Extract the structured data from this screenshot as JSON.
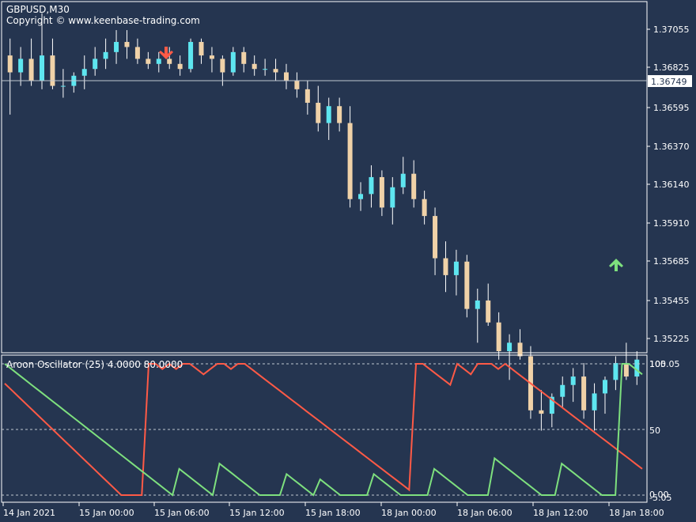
{
  "window": {
    "symbol_timeframe": "GBPUSD,M30",
    "copyright": "Copyright © www.keenbase-trading.com"
  },
  "price_axis": {
    "ticks": [
      "1.37055",
      "1.36825",
      "1.36595",
      "1.36370",
      "1.36140",
      "1.35910",
      "1.35685",
      "1.35455",
      "1.35225"
    ],
    "current_price": "1.36749"
  },
  "indicator": {
    "label": "Aroon Oscillator (25) 4.0000 80.0000",
    "axis_labels": [
      "105.05",
      "100",
      "50",
      "0.00",
      "-5.05"
    ]
  },
  "time_axis": {
    "labels": [
      "14 Jan 2021",
      "15 Jan 00:00",
      "15 Jan 06:00",
      "15 Jan 12:00",
      "15 Jan 18:00",
      "18 Jan 00:00",
      "18 Jan 06:00",
      "18 Jan 12:00",
      "18 Jan 18:00"
    ]
  },
  "signals": [
    {
      "type": "sell",
      "icon": "down-arrow-icon",
      "color": "#ff5a46"
    },
    {
      "type": "buy",
      "icon": "up-arrow-icon",
      "color": "#7ee07e"
    }
  ],
  "colors": {
    "background": "#253550",
    "bull_candle": "#5ee6f0",
    "bear_candle": "#f0d2a8",
    "aroon_up": "#7ee07e",
    "aroon_down": "#ff5a46",
    "grid": "#ffffff"
  },
  "chart_data": {
    "type": "candlestick",
    "price_series": [
      {
        "o": 1.369,
        "h": 1.37,
        "l": 1.3655,
        "c": 1.368
      },
      {
        "o": 1.368,
        "h": 1.3695,
        "l": 1.3672,
        "c": 1.3688
      },
      {
        "o": 1.3688,
        "h": 1.37,
        "l": 1.3672,
        "c": 1.3675
      },
      {
        "o": 1.3675,
        "h": 1.3715,
        "l": 1.367,
        "c": 1.369
      },
      {
        "o": 1.369,
        "h": 1.37,
        "l": 1.367,
        "c": 1.3672
      },
      {
        "o": 1.3672,
        "h": 1.3682,
        "l": 1.3665,
        "c": 1.3672
      },
      {
        "o": 1.3672,
        "h": 1.368,
        "l": 1.3668,
        "c": 1.3678
      },
      {
        "o": 1.3678,
        "h": 1.369,
        "l": 1.367,
        "c": 1.3682
      },
      {
        "o": 1.3682,
        "h": 1.3695,
        "l": 1.3678,
        "c": 1.3688
      },
      {
        "o": 1.3688,
        "h": 1.37,
        "l": 1.3682,
        "c": 1.3692
      },
      {
        "o": 1.3692,
        "h": 1.3705,
        "l": 1.3685,
        "c": 1.3698
      },
      {
        "o": 1.3698,
        "h": 1.3705,
        "l": 1.3688,
        "c": 1.3695
      },
      {
        "o": 1.3695,
        "h": 1.37,
        "l": 1.3685,
        "c": 1.3688
      },
      {
        "o": 1.3688,
        "h": 1.3692,
        "l": 1.3682,
        "c": 1.3685
      },
      {
        "o": 1.3685,
        "h": 1.3692,
        "l": 1.368,
        "c": 1.3688
      },
      {
        "o": 1.3688,
        "h": 1.3695,
        "l": 1.3682,
        "c": 1.3685
      },
      {
        "o": 1.3685,
        "h": 1.369,
        "l": 1.3678,
        "c": 1.3682
      },
      {
        "o": 1.3682,
        "h": 1.37,
        "l": 1.368,
        "c": 1.3698
      },
      {
        "o": 1.3698,
        "h": 1.37,
        "l": 1.3685,
        "c": 1.369
      },
      {
        "o": 1.369,
        "h": 1.3695,
        "l": 1.368,
        "c": 1.3688
      },
      {
        "o": 1.3688,
        "h": 1.369,
        "l": 1.3672,
        "c": 1.368
      },
      {
        "o": 1.368,
        "h": 1.3695,
        "l": 1.3678,
        "c": 1.3692
      },
      {
        "o": 1.3692,
        "h": 1.3695,
        "l": 1.368,
        "c": 1.3685
      },
      {
        "o": 1.3685,
        "h": 1.369,
        "l": 1.3678,
        "c": 1.3682
      },
      {
        "o": 1.3682,
        "h": 1.3688,
        "l": 1.3678,
        "c": 1.3682
      },
      {
        "o": 1.3682,
        "h": 1.3688,
        "l": 1.3675,
        "c": 1.368
      },
      {
        "o": 1.368,
        "h": 1.3685,
        "l": 1.367,
        "c": 1.3675
      },
      {
        "o": 1.3675,
        "h": 1.368,
        "l": 1.3665,
        "c": 1.367
      },
      {
        "o": 1.367,
        "h": 1.3675,
        "l": 1.3655,
        "c": 1.3662
      },
      {
        "o": 1.3662,
        "h": 1.3672,
        "l": 1.3645,
        "c": 1.365
      },
      {
        "o": 1.365,
        "h": 1.3665,
        "l": 1.364,
        "c": 1.366
      },
      {
        "o": 1.366,
        "h": 1.3665,
        "l": 1.3645,
        "c": 1.365
      },
      {
        "o": 1.365,
        "h": 1.366,
        "l": 1.36,
        "c": 1.3605
      },
      {
        "o": 1.3605,
        "h": 1.3615,
        "l": 1.3598,
        "c": 1.3608
      },
      {
        "o": 1.3608,
        "h": 1.3625,
        "l": 1.36,
        "c": 1.3618
      },
      {
        "o": 1.3618,
        "h": 1.3622,
        "l": 1.3595,
        "c": 1.36
      },
      {
        "o": 1.36,
        "h": 1.3618,
        "l": 1.359,
        "c": 1.3612
      },
      {
        "o": 1.3612,
        "h": 1.363,
        "l": 1.3608,
        "c": 1.362
      },
      {
        "o": 1.362,
        "h": 1.3628,
        "l": 1.36,
        "c": 1.3605
      },
      {
        "o": 1.3605,
        "h": 1.361,
        "l": 1.359,
        "c": 1.3595
      },
      {
        "o": 1.3595,
        "h": 1.36,
        "l": 1.356,
        "c": 1.357
      },
      {
        "o": 1.357,
        "h": 1.358,
        "l": 1.355,
        "c": 1.356
      },
      {
        "o": 1.356,
        "h": 1.3575,
        "l": 1.3548,
        "c": 1.3568
      },
      {
        "o": 1.3568,
        "h": 1.3572,
        "l": 1.3535,
        "c": 1.354
      },
      {
        "o": 1.354,
        "h": 1.3552,
        "l": 1.352,
        "c": 1.3545
      },
      {
        "o": 1.3545,
        "h": 1.3555,
        "l": 1.353,
        "c": 1.3532
      },
      {
        "o": 1.3532,
        "h": 1.3538,
        "l": 1.351,
        "c": 1.3515
      },
      {
        "o": 1.3515,
        "h": 1.3525,
        "l": 1.3498,
        "c": 1.352
      },
      {
        "o": 1.352,
        "h": 1.3528,
        "l": 1.351,
        "c": 1.3512
      },
      {
        "o": 1.3512,
        "h": 1.3518,
        "l": 1.3475,
        "c": 1.348
      },
      {
        "o": 1.348,
        "h": 1.3492,
        "l": 1.3468,
        "c": 1.3478
      },
      {
        "o": 1.3478,
        "h": 1.349,
        "l": 1.347,
        "c": 1.3488
      },
      {
        "o": 1.3488,
        "h": 1.35,
        "l": 1.3482,
        "c": 1.3495
      },
      {
        "o": 1.3495,
        "h": 1.3505,
        "l": 1.3485,
        "c": 1.35
      },
      {
        "o": 1.35,
        "h": 1.3508,
        "l": 1.3475,
        "c": 1.348
      },
      {
        "o": 1.348,
        "h": 1.3496,
        "l": 1.3468,
        "c": 1.349
      },
      {
        "o": 1.349,
        "h": 1.35,
        "l": 1.3478,
        "c": 1.3498
      },
      {
        "o": 1.3498,
        "h": 1.3512,
        "l": 1.3492,
        "c": 1.3508
      },
      {
        "o": 1.3508,
        "h": 1.352,
        "l": 1.3498,
        "c": 1.35
      },
      {
        "o": 1.35,
        "h": 1.3515,
        "l": 1.3495,
        "c": 1.351
      }
    ],
    "aroon_down": [
      85,
      80,
      75,
      70,
      65,
      60,
      55,
      50,
      45,
      40,
      35,
      30,
      25,
      20,
      15,
      10,
      5,
      0,
      0,
      0,
      0,
      100,
      100,
      96,
      100,
      96,
      100,
      100,
      96,
      92,
      96,
      100,
      100,
      96,
      100,
      100,
      96,
      92,
      88,
      84,
      80,
      76,
      72,
      68,
      64,
      60,
      56,
      52,
      48,
      44,
      40,
      36,
      32,
      28,
      24,
      20,
      16,
      12,
      8,
      4,
      100,
      100,
      96,
      92,
      88,
      84,
      100,
      96,
      92,
      100,
      100,
      100,
      96,
      100,
      96,
      92,
      88,
      84,
      80,
      76,
      72,
      68,
      64,
      60,
      56,
      52,
      48,
      44,
      40,
      36,
      32,
      28,
      24,
      20
    ],
    "aroon_up": [
      100,
      96,
      92,
      88,
      84,
      80,
      76,
      72,
      68,
      64,
      60,
      56,
      52,
      48,
      44,
      40,
      36,
      32,
      28,
      24,
      20,
      16,
      12,
      8,
      4,
      0,
      20,
      16,
      12,
      8,
      4,
      0,
      24,
      20,
      16,
      12,
      8,
      4,
      0,
      0,
      0,
      0,
      16,
      12,
      8,
      4,
      0,
      12,
      8,
      4,
      0,
      0,
      0,
      0,
      0,
      16,
      12,
      8,
      4,
      0,
      0,
      0,
      0,
      0,
      20,
      16,
      12,
      8,
      4,
      0,
      0,
      0,
      0,
      28,
      24,
      20,
      16,
      12,
      8,
      4,
      0,
      0,
      0,
      24,
      20,
      16,
      12,
      8,
      4,
      0,
      0,
      0,
      100,
      100,
      96,
      92
    ],
    "aroon_levels": [
      5,
      50,
      95
    ]
  }
}
